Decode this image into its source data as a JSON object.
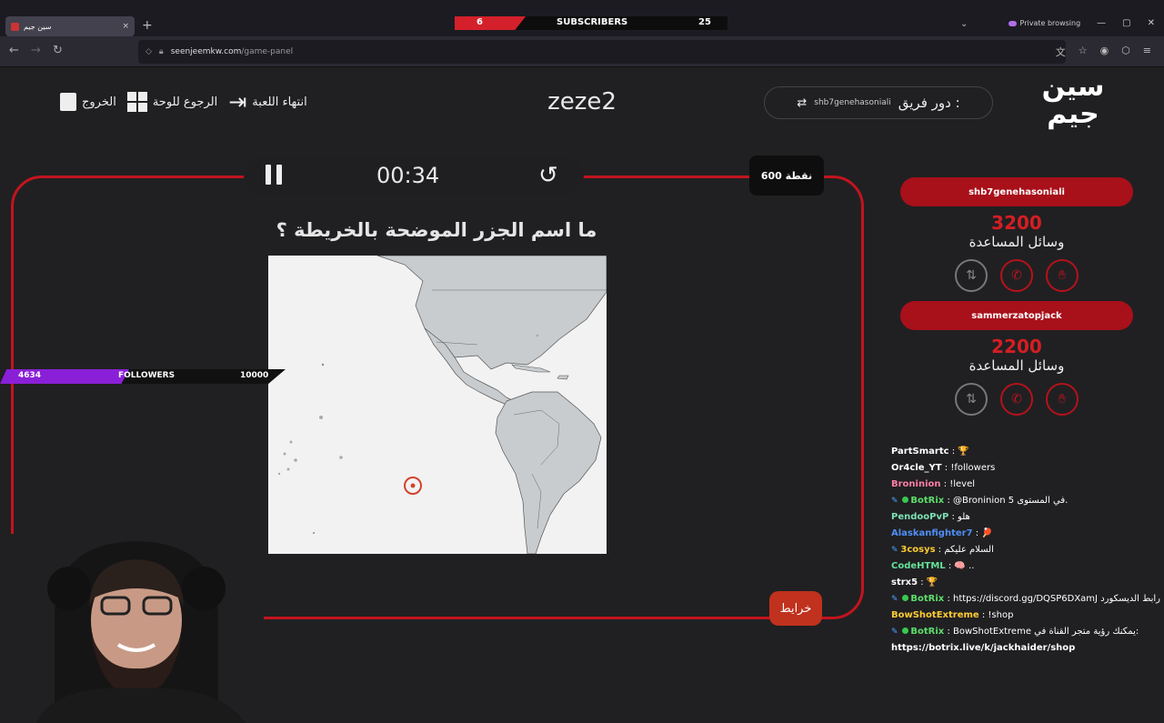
{
  "browser": {
    "tab_title": "سين جيم",
    "tab_close": "×",
    "new_tab": "+",
    "private_label": "Private browsing",
    "url_host": "seenjeemkw.com",
    "url_path": "/game-panel",
    "nav_back": "←",
    "nav_forward": "→",
    "nav_reload": "↻",
    "win_min": "—",
    "win_max": "▢",
    "win_close": "✕",
    "tabs_menu": "⌄"
  },
  "overlay": {
    "subscribers_left": "6",
    "subscribers_label": "SUBSCRIBERS",
    "subscribers_right": "25",
    "followers_left": "4634",
    "followers_label": "FOLLOWERS",
    "followers_right": "10000"
  },
  "header": {
    "logo_line1": "سين",
    "logo_line2": "جيم",
    "team_turn_label": "دور فريق :",
    "team_turn_name": "shb7genehasoniali",
    "game_title": "zeze2",
    "end_game": "انتهاء اللعبة",
    "back_to_board": "الرجوع للوحة",
    "exit": "الخروج"
  },
  "question_panel": {
    "timer": "00:34",
    "points": "600 نقطة",
    "question": "ما اسم الجزر الموضحة بالخريطة ؟",
    "category_button": "خرايط"
  },
  "teams": [
    {
      "name": "shb7genehasoniali",
      "score": "3200",
      "help_label": "وسائل المساعدة"
    },
    {
      "name": "sammerzatopjack",
      "score": "2200",
      "help_label": "وسائل المساعدة"
    }
  ],
  "chat": [
    {
      "user": "PartSmartc",
      "color": "#ffffff",
      "text": " : 🏆",
      "bot": false
    },
    {
      "user": "Or4cle_YT",
      "color": "#ffffff",
      "text": " : !followers",
      "bot": false
    },
    {
      "user": "Broninion",
      "color": "#ff7fa5",
      "text": " : !level",
      "bot": false
    },
    {
      "user": "BotRix",
      "color": "#5cdd6b",
      "text": " : @Broninion 5 في المستوى.",
      "bot": true
    },
    {
      "user": "PendooPvP",
      "color": "#7ee0b4",
      "text": " : هلو",
      "bot": false
    },
    {
      "user": "Alaskanfighter7",
      "color": "#4f8ef5",
      "text": " : 🏓",
      "bot": false
    },
    {
      "user": "3cosys",
      "color": "#ffcc33",
      "text": " : السلام عليكم",
      "bot": false,
      "bot2": true
    },
    {
      "user": "CodeHTML",
      "color": "#66e099",
      "text": " : 🧠 ..",
      "bot": false
    },
    {
      "user": "strx5",
      "color": "#ffffff",
      "text": " : 🏆",
      "bot": false
    },
    {
      "user": "BotRix",
      "color": "#5cdd6b",
      "text": " : https://discord.gg/DQSP6DXamJ رابط الديسكورد",
      "bot": true
    },
    {
      "user": "BowShotExtreme",
      "color": "#ffcc33",
      "text": " : !shop",
      "bot": false
    },
    {
      "user": "BotRix",
      "color": "#5cdd6b",
      "text": " : BowShotExtreme يمكنك رؤية متجر القناة في:",
      "bot": true
    },
    {
      "user": "",
      "color": "#ffffff",
      "text": "https://botrix.live/k/jackhaider/shop",
      "bot": false
    }
  ],
  "colors": {
    "accent_red": "#c2141e",
    "followers_purple": "#8a1fd8",
    "page_bg": "#202022"
  }
}
